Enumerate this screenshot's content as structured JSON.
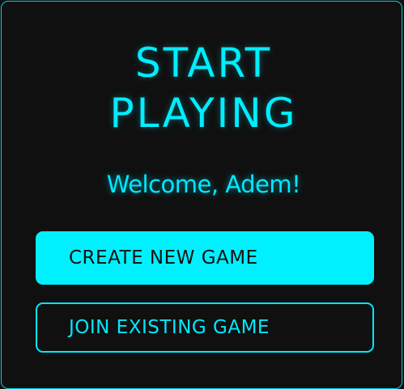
{
  "heading": {
    "line1": "START",
    "line2": "PLAYING"
  },
  "welcome_text": "Welcome, Adem!",
  "actions": {
    "create_label": "CREATE NEW GAME",
    "join_label": "JOIN EXISTING GAME"
  },
  "colors": {
    "accent": "#00f0ff",
    "background": "#101010",
    "button_text_dark": "#111111"
  }
}
